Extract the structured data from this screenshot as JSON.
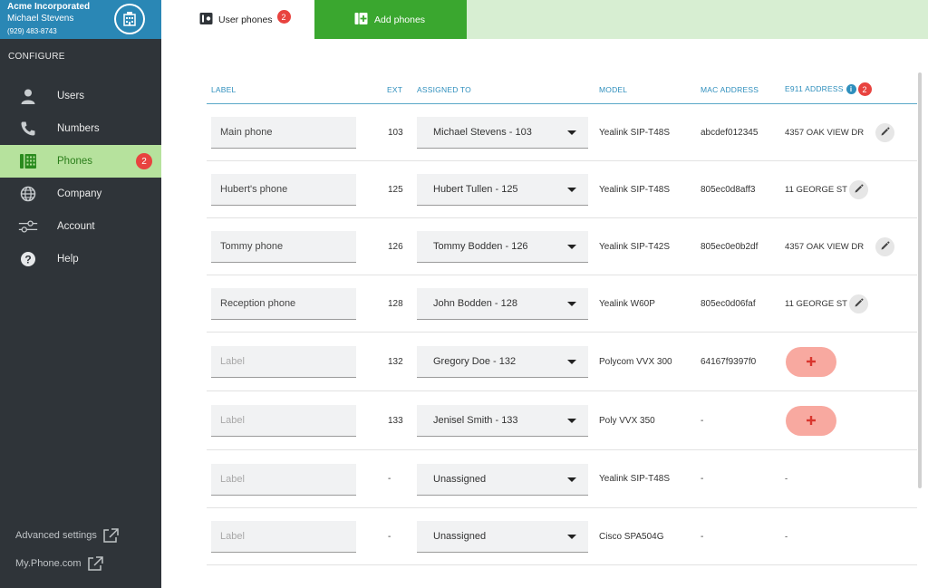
{
  "account": {
    "company": "Acme Incorporated",
    "user": "Michael Stevens",
    "phone": "(929) 483-8743"
  },
  "sidebar": {
    "section_title": "CONFIGURE",
    "items": [
      {
        "label": "Users",
        "icon": "user-icon"
      },
      {
        "label": "Numbers",
        "icon": "phone-handset-icon"
      },
      {
        "label": "Phones",
        "icon": "desk-phone-icon",
        "badge": "2",
        "active": true
      },
      {
        "label": "Company",
        "icon": "globe-icon"
      },
      {
        "label": "Account",
        "icon": "sliders-icon"
      },
      {
        "label": "Help",
        "icon": "help-icon"
      }
    ],
    "advanced_settings": "Advanced settings",
    "my_phone": "My.Phone.com"
  },
  "tabs": {
    "user_phones": {
      "label": "User phones",
      "badge": "2"
    },
    "add_phones": {
      "label": "Add phones"
    }
  },
  "table": {
    "headers": {
      "label": "LABEL",
      "ext": "EXT",
      "assigned_to": "ASSIGNED TO",
      "model": "MODEL",
      "mac": "MAC ADDRESS",
      "e911": "E911 ADDRESS",
      "e911_info": "i",
      "e911_badge": "2"
    },
    "label_placeholder": "Label",
    "rows": [
      {
        "label": "Main phone",
        "ext": "103",
        "assigned": "Michael Stevens - 103",
        "model": "Yealink SIP-T48S",
        "mac": "abcdef012345",
        "e911": "4357 OAK VIEW DR",
        "e911_action": "edit"
      },
      {
        "label": "Hubert's phone",
        "ext": "125",
        "assigned": "Hubert Tullen - 125",
        "model": "Yealink SIP-T48S",
        "mac": "805ec0d8aff3",
        "e911": "11 GEORGE ST",
        "e911_action": "edit"
      },
      {
        "label": "Tommy phone",
        "ext": "126",
        "assigned": "Tommy Bodden - 126",
        "model": "Yealink SIP-T42S",
        "mac": "805ec0e0b2df",
        "e911": "4357 OAK VIEW DR",
        "e911_action": "edit"
      },
      {
        "label": "Reception phone",
        "ext": "128",
        "assigned": "John Bodden - 128",
        "model": "Yealink W60P",
        "mac": "805ec0d06faf",
        "e911": "11 GEORGE ST",
        "e911_action": "edit"
      },
      {
        "label": "",
        "ext": "132",
        "assigned": "Gregory Doe - 132",
        "model": "Polycom VVX 300",
        "mac": "64167f9397f0",
        "e911": "",
        "e911_action": "add"
      },
      {
        "label": "",
        "ext": "133",
        "assigned": "Jenisel Smith - 133",
        "model": "Poly VVX 350",
        "mac": "-",
        "e911": "",
        "e911_action": "add"
      },
      {
        "label": "",
        "ext": "-",
        "assigned": "Unassigned",
        "model": "Yealink SIP-T48S",
        "mac": "-",
        "e911": "-",
        "e911_action": "none"
      },
      {
        "label": "",
        "ext": "-",
        "assigned": "Unassigned",
        "model": "Cisco SPA504G",
        "mac": "-",
        "e911": "-",
        "e911_action": "none"
      }
    ]
  },
  "colors": {
    "sidebar_bg": "#2f3439",
    "account_bg": "#2a87b5",
    "active_nav_bg": "#b6e29d",
    "add_tab_bg": "#3aa72f",
    "header_text": "#2f8fbd",
    "badge": "#e8433f",
    "add_button": "#f8a9a0"
  }
}
